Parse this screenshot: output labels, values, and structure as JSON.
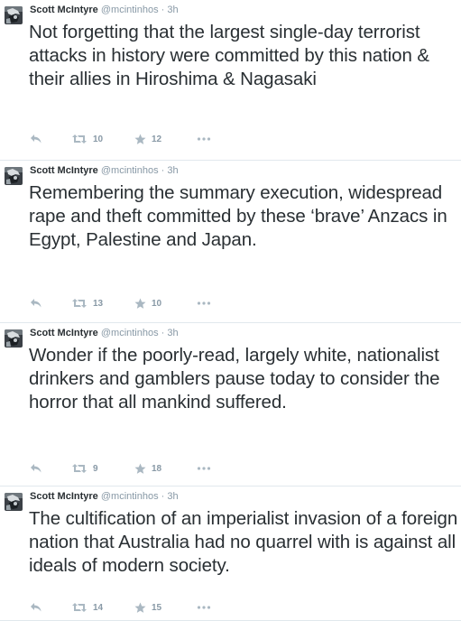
{
  "colors": {
    "name": "#292f33",
    "meta": "#8899a6",
    "icon": "#aab8c2",
    "divider": "#e1e8ed",
    "background": "#ffffff"
  },
  "tweets": [
    {
      "name": "Scott McIntyre",
      "handle": "@mcintinhos",
      "separator": "·",
      "time": "3h",
      "text": "Not forgetting that the largest single-day terrorist attacks in history were committed by this nation & their allies in Hiroshima & Nagasaki",
      "reply_icon": "reply-icon",
      "retweet_icon": "retweet-icon",
      "retweets": "10",
      "favorite_icon": "star-icon",
      "favorites": "12",
      "more_icon": "more-dots-icon"
    },
    {
      "name": "Scott McIntyre",
      "handle": "@mcintinhos",
      "separator": "·",
      "time": "3h",
      "text": "Remembering the summary execution, widespread rape and theft committed by these ‘brave’ Anzacs in Egypt, Palestine and Japan.",
      "reply_icon": "reply-icon",
      "retweet_icon": "retweet-icon",
      "retweets": "13",
      "favorite_icon": "star-icon",
      "favorites": "10",
      "more_icon": "more-dots-icon"
    },
    {
      "name": "Scott McIntyre",
      "handle": "@mcintinhos",
      "separator": "·",
      "time": "3h",
      "text": "Wonder if the poorly-read, largely white, nationalist drinkers and gamblers pause today to consider the horror that all mankind suffered.",
      "reply_icon": "reply-icon",
      "retweet_icon": "retweet-icon",
      "retweets": "9",
      "favorite_icon": "star-icon",
      "favorites": "18",
      "more_icon": "more-dots-icon"
    },
    {
      "name": "Scott McIntyre",
      "handle": "@mcintinhos",
      "separator": "·",
      "time": "3h",
      "text": "The cultification of an imperialist invasion of a foreign nation that Australia had no quarrel with is against all ideals of modern society.",
      "reply_icon": "reply-icon",
      "retweet_icon": "retweet-icon",
      "retweets": "14",
      "favorite_icon": "star-icon",
      "favorites": "15",
      "more_icon": "more-dots-icon"
    }
  ]
}
